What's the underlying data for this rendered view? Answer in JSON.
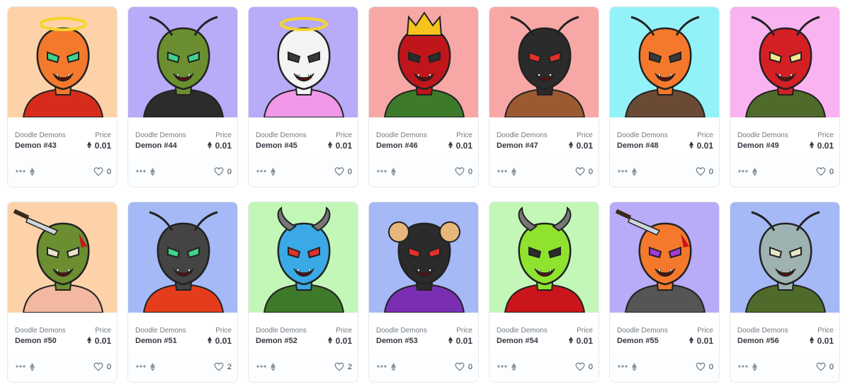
{
  "cards": [
    {
      "collection": "Doodle Demons",
      "price_label": "Price",
      "name": "Demon #43",
      "price": "0.01",
      "likes": "0",
      "bg": "#fed2a9",
      "skin": "#f4792d",
      "eyes": "#3fd48a",
      "accessory": "halo-icon",
      "clothes": "#d72c1c"
    },
    {
      "collection": "Doodle Demons",
      "price_label": "Price",
      "name": "Demon #44",
      "price": "0.01",
      "likes": "0",
      "bg": "#b8abf7",
      "skin": "#6b8f30",
      "eyes": "#3fd48a",
      "accessory": "antennae-icon",
      "clothes": "#2c2c2c"
    },
    {
      "collection": "Doodle Demons",
      "price_label": "Price",
      "name": "Demon #45",
      "price": "0.01",
      "likes": "0",
      "bg": "#b8abf7",
      "skin": "#f4f4f4",
      "eyes": "#3a3a3a",
      "accessory": "halo-icon",
      "clothes": "#f198e8"
    },
    {
      "collection": "Doodle Demons",
      "price_label": "Price",
      "name": "Demon #46",
      "price": "0.01",
      "likes": "0",
      "bg": "#f8a7a7",
      "skin": "#c0161b",
      "eyes": "#2d2d2d",
      "accessory": "crown-icon",
      "clothes": "#3d7a2a"
    },
    {
      "collection": "Doodle Demons",
      "price_label": "Price",
      "name": "Demon #47",
      "price": "0.01",
      "likes": "0",
      "bg": "#f8a7a7",
      "skin": "#2b2b2b",
      "eyes": "#e0302a",
      "accessory": "antennae-icon",
      "clothes": "#9c5a33"
    },
    {
      "collection": "Doodle Demons",
      "price_label": "Price",
      "name": "Demon #48",
      "price": "0.01",
      "likes": "0",
      "bg": "#93f2f8",
      "skin": "#f4792d",
      "eyes": "#3a3a3a",
      "accessory": "antennae-icon",
      "clothes": "#6b4a35"
    },
    {
      "collection": "Doodle Demons",
      "price_label": "Price",
      "name": "Demon #49",
      "price": "0.01",
      "likes": "0",
      "bg": "#f9b3f0",
      "skin": "#d41f25",
      "eyes": "#f7e68c",
      "accessory": "antennae-icon",
      "clothes": "#4f6b2c"
    },
    {
      "collection": "Doodle Demons",
      "price_label": "Price",
      "name": "Demon #50",
      "price": "0.01",
      "likes": "0",
      "bg": "#fed2a9",
      "skin": "#6b8f30",
      "eyes": "#e6e6c8",
      "accessory": "knife-icon",
      "clothes": "#f2b9a0"
    },
    {
      "collection": "Doodle Demons",
      "price_label": "Price",
      "name": "Demon #51",
      "price": "0.01",
      "likes": "2",
      "bg": "#a4b9f5",
      "skin": "#444444",
      "eyes": "#3fd48a",
      "accessory": "antennae-icon",
      "clothes": "#e53d1c"
    },
    {
      "collection": "Doodle Demons",
      "price_label": "Price",
      "name": "Demon #52",
      "price": "0.01",
      "likes": "2",
      "bg": "#c2f7b8",
      "skin": "#3aa9e6",
      "eyes": "#e0302a",
      "accessory": "horns-icon",
      "clothes": "#3d7a2a"
    },
    {
      "collection": "Doodle Demons",
      "price_label": "Price",
      "name": "Demon #53",
      "price": "0.01",
      "likes": "0",
      "bg": "#a4b9f5",
      "skin": "#2b2b2b",
      "eyes": "#e0302a",
      "accessory": "ram-horns-icon",
      "clothes": "#7a2fb3"
    },
    {
      "collection": "Doodle Demons",
      "price_label": "Price",
      "name": "Demon #54",
      "price": "0.01",
      "likes": "0",
      "bg": "#c2f7b8",
      "skin": "#8fe32e",
      "eyes": "#2d2d2d",
      "accessory": "horns-icon",
      "clothes": "#c9151b"
    },
    {
      "collection": "Doodle Demons",
      "price_label": "Price",
      "name": "Demon #55",
      "price": "0.01",
      "likes": "0",
      "bg": "#b8abf7",
      "skin": "#f4792d",
      "eyes": "#a13ad6",
      "accessory": "knife-icon",
      "clothes": "#555555"
    },
    {
      "collection": "Doodle Demons",
      "price_label": "Price",
      "name": "Demon #56",
      "price": "0.01",
      "likes": "0",
      "bg": "#a4b9f5",
      "skin": "#9fb2b2",
      "eyes": "#e6e6c8",
      "accessory": "antennae-icon",
      "clothes": "#4f6b2c"
    }
  ]
}
